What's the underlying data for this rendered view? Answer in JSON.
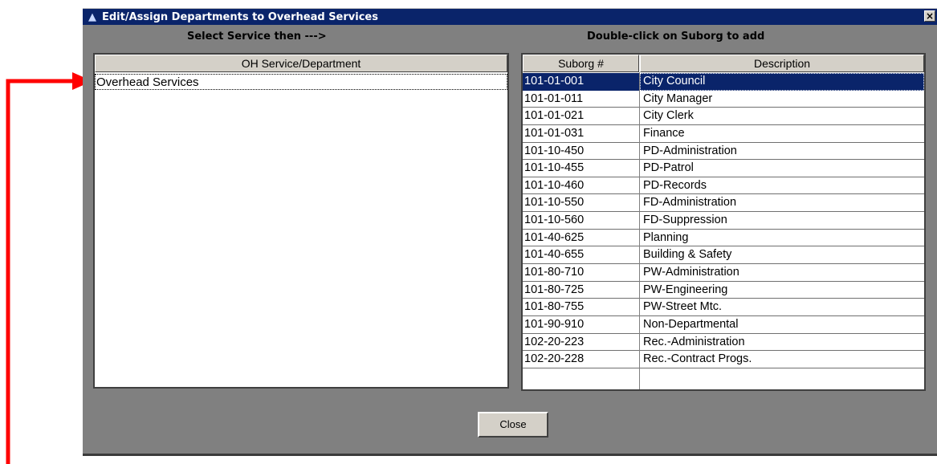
{
  "window": {
    "title": "Edit/Assign Departments to Overhead Services",
    "close_glyph": "×",
    "app_icon": "app-logo-icon"
  },
  "left_panel": {
    "label": "Select Service then --->",
    "column_header": "OH Service/Department",
    "items": [
      {
        "label": "Overhead Services"
      }
    ]
  },
  "right_panel": {
    "label": "Double-click on Suborg to add",
    "columns": {
      "suborg": "Suborg #",
      "description": "Description"
    },
    "selected_index": 0,
    "rows": [
      {
        "suborg": "101-01-001",
        "description": "City Council"
      },
      {
        "suborg": "101-01-011",
        "description": "City Manager"
      },
      {
        "suborg": "101-01-021",
        "description": "City Clerk"
      },
      {
        "suborg": "101-01-031",
        "description": "Finance"
      },
      {
        "suborg": "101-10-450",
        "description": "PD-Administration"
      },
      {
        "suborg": "101-10-455",
        "description": "PD-Patrol"
      },
      {
        "suborg": "101-10-460",
        "description": "PD-Records"
      },
      {
        "suborg": "101-10-550",
        "description": "FD-Administration"
      },
      {
        "suborg": "101-10-560",
        "description": "FD-Suppression"
      },
      {
        "suborg": "101-40-625",
        "description": "Planning"
      },
      {
        "suborg": "101-40-655",
        "description": "Building & Safety"
      },
      {
        "suborg": "101-80-710",
        "description": "PW-Administration"
      },
      {
        "suborg": "101-80-725",
        "description": "PW-Engineering"
      },
      {
        "suborg": "101-80-755",
        "description": "PW-Street Mtc."
      },
      {
        "suborg": "101-90-910",
        "description": "Non-Departmental"
      },
      {
        "suborg": "102-20-223",
        "description": "Rec.-Administration"
      },
      {
        "suborg": "102-20-228",
        "description": "Rec.-Contract Progs."
      }
    ]
  },
  "buttons": {
    "close": "Close"
  },
  "colors": {
    "titlebar": "#0a246a",
    "selection": "#0a246a",
    "annotation_arrow": "#ff0000",
    "dialog_background": "#808080"
  }
}
